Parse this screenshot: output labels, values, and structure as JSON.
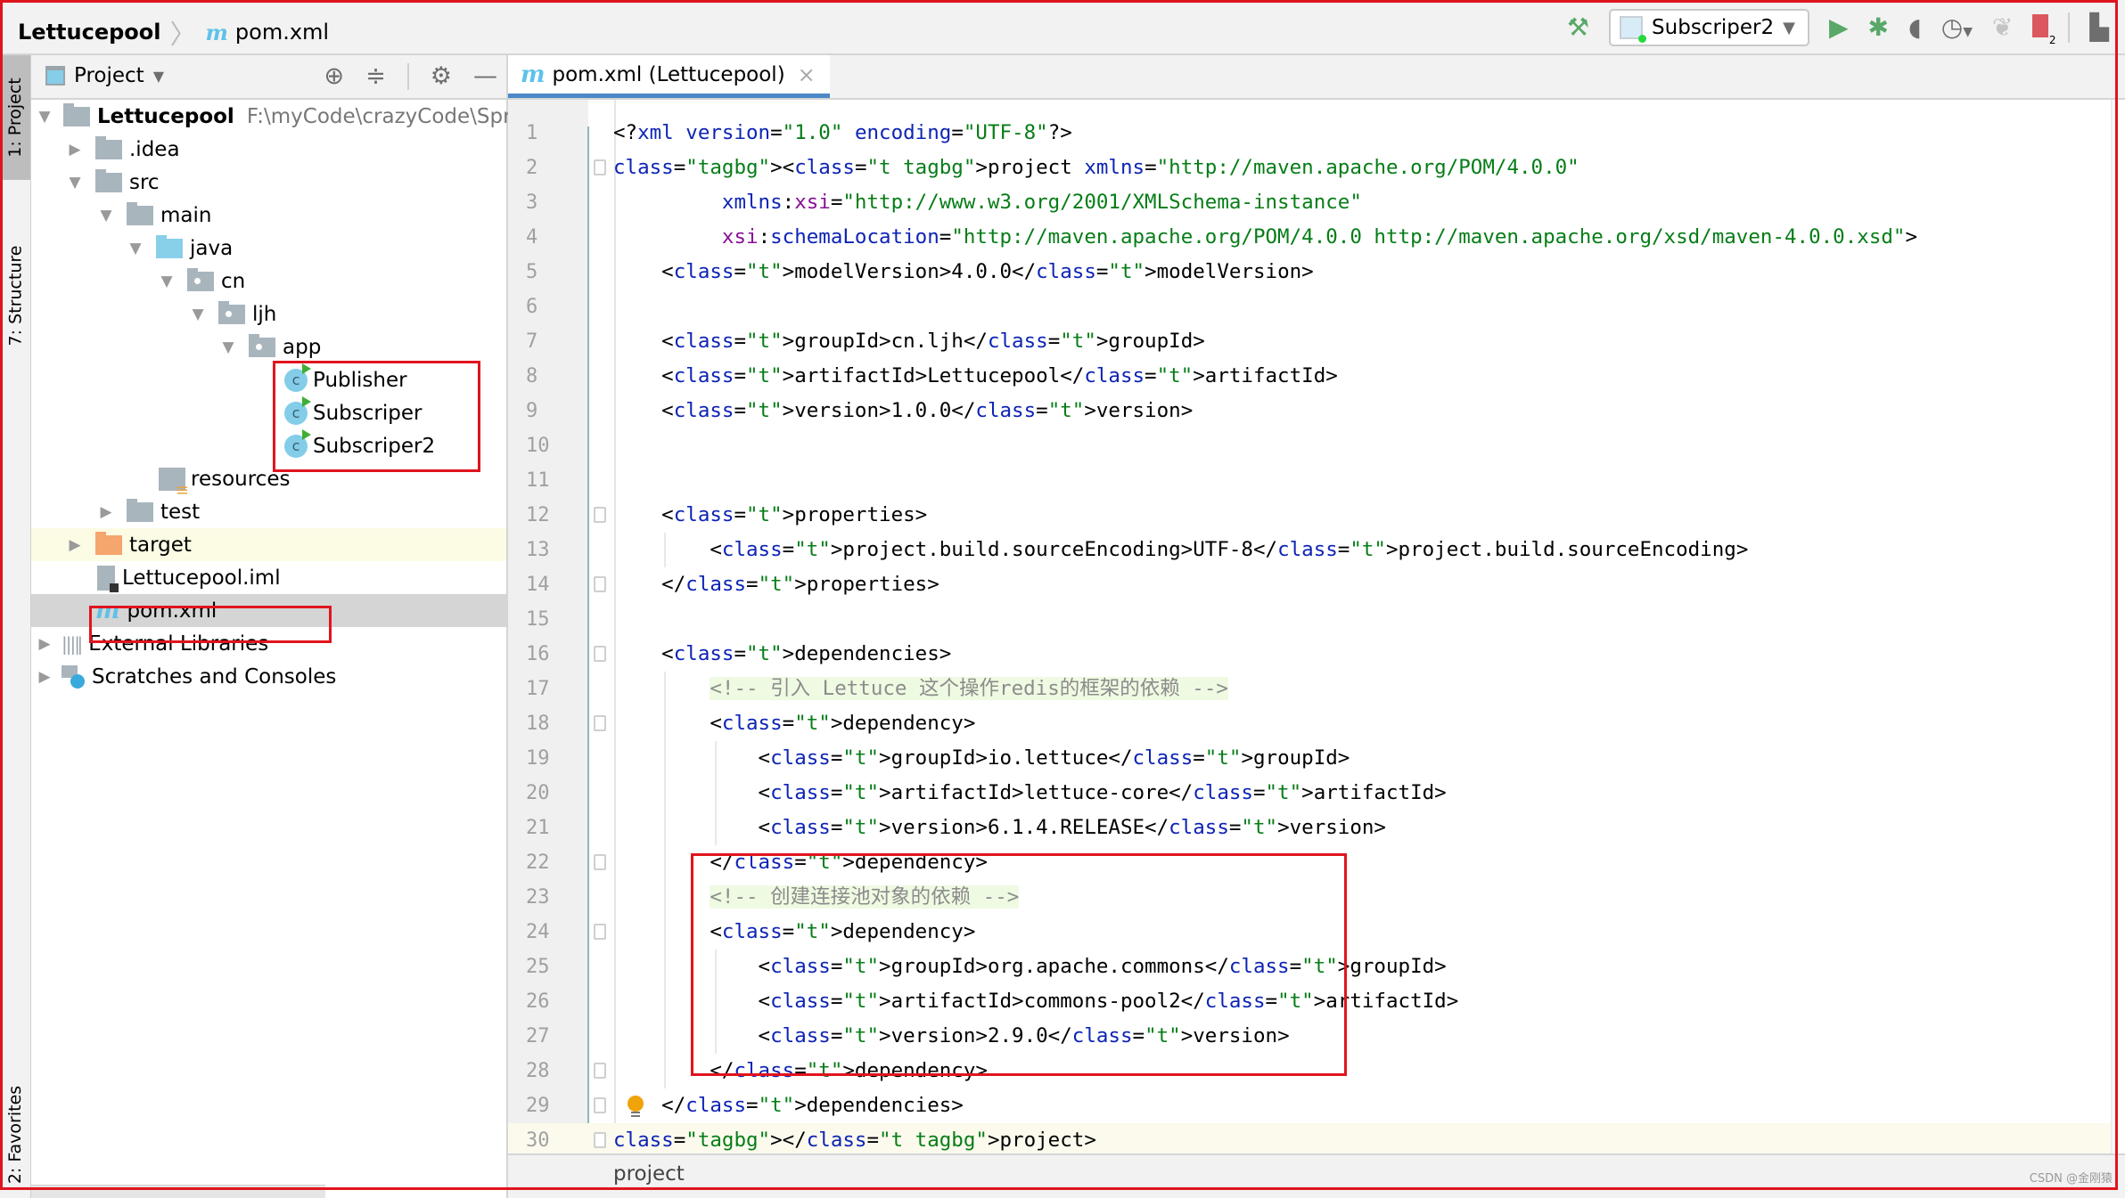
{
  "navbar": {
    "project": "Lettucepool",
    "file_icon": "maven-m-icon",
    "file": "pom.xml"
  },
  "toolbar": {
    "build_icon": "hammer-icon",
    "run_config": "Subscriper2",
    "run_icon": "play-icon",
    "debug_icon": "bug-icon",
    "coverage_icon": "coverage-icon",
    "profile_icon": "profiler-icon",
    "attach_icon": "attach-icon",
    "stop_icon": "stop-icon",
    "stop_count": "2",
    "project_structure_icon": "project-structure-icon"
  },
  "stripe": {
    "project": "1: Project",
    "structure": "7: Structure",
    "favorites": "2: Favorites"
  },
  "project_panel": {
    "title": "Project",
    "tree": [
      {
        "label": "Lettucepool",
        "path": "F:\\myCode\\crazyCode\\SpringB",
        "type": "module"
      },
      {
        "label": ".idea",
        "type": "folder"
      },
      {
        "label": "src",
        "type": "folder"
      },
      {
        "label": "main",
        "type": "folder"
      },
      {
        "label": "java",
        "type": "source-folder"
      },
      {
        "label": "cn",
        "type": "package"
      },
      {
        "label": "ljh",
        "type": "package"
      },
      {
        "label": "app",
        "type": "package"
      },
      {
        "label": "Publisher",
        "type": "class"
      },
      {
        "label": "Subscriper",
        "type": "class"
      },
      {
        "label": "Subscriper2",
        "type": "class"
      },
      {
        "label": "resources",
        "type": "resources"
      },
      {
        "label": "test",
        "type": "folder"
      },
      {
        "label": "target",
        "type": "excluded-folder"
      },
      {
        "label": "Lettucepool.iml",
        "type": "iml"
      },
      {
        "label": "pom.xml",
        "type": "maven"
      },
      {
        "label": "External Libraries",
        "type": "libraries"
      },
      {
        "label": "Scratches and Consoles",
        "type": "scratches"
      }
    ]
  },
  "editor": {
    "tab": "pom.xml (Lettucepool)",
    "lines": [
      "<?xml version=\"1.0\" encoding=\"UTF-8\"?>",
      "<project xmlns=\"http://maven.apache.org/POM/4.0.0\"",
      "         xmlns:xsi=\"http://www.w3.org/2001/XMLSchema-instance\"",
      "         xsi:schemaLocation=\"http://maven.apache.org/POM/4.0.0 http://maven.apache.org/xsd/maven-4.0.0.xsd\">",
      "    <modelVersion>4.0.0</modelVersion>",
      "",
      "    <groupId>cn.ljh</groupId>",
      "    <artifactId>Lettucepool</artifactId>",
      "    <version>1.0.0</version>",
      "",
      "",
      "    <properties>",
      "        <project.build.sourceEncoding>UTF-8</project.build.sourceEncoding>",
      "    </properties>",
      "",
      "    <dependencies>",
      "        <!-- 引入 Lettuce 这个操作redis的框架的依赖 -->",
      "        <dependency>",
      "            <groupId>io.lettuce</groupId>",
      "            <artifactId>lettuce-core</artifactId>",
      "            <version>6.1.4.RELEASE</version>",
      "        </dependency>",
      "        <!-- 创建连接池对象的依赖 -->",
      "        <dependency>",
      "            <groupId>org.apache.commons</groupId>",
      "            <artifactId>commons-pool2</artifactId>",
      "            <version>2.9.0</version>",
      "        </dependency>",
      "    </dependencies>",
      "</project>"
    ],
    "current_line": 30,
    "breadcrumb": "project"
  },
  "watermark": "CSDN @金刚猿",
  "colors": {
    "tag": "#0d24b5",
    "string": "#067d17",
    "namespace": "#871094",
    "comment": "#8c8c8c",
    "comment_bg": "#effae2",
    "tab_underline": "#4a88c7",
    "annotation_red": "#e0141e"
  }
}
